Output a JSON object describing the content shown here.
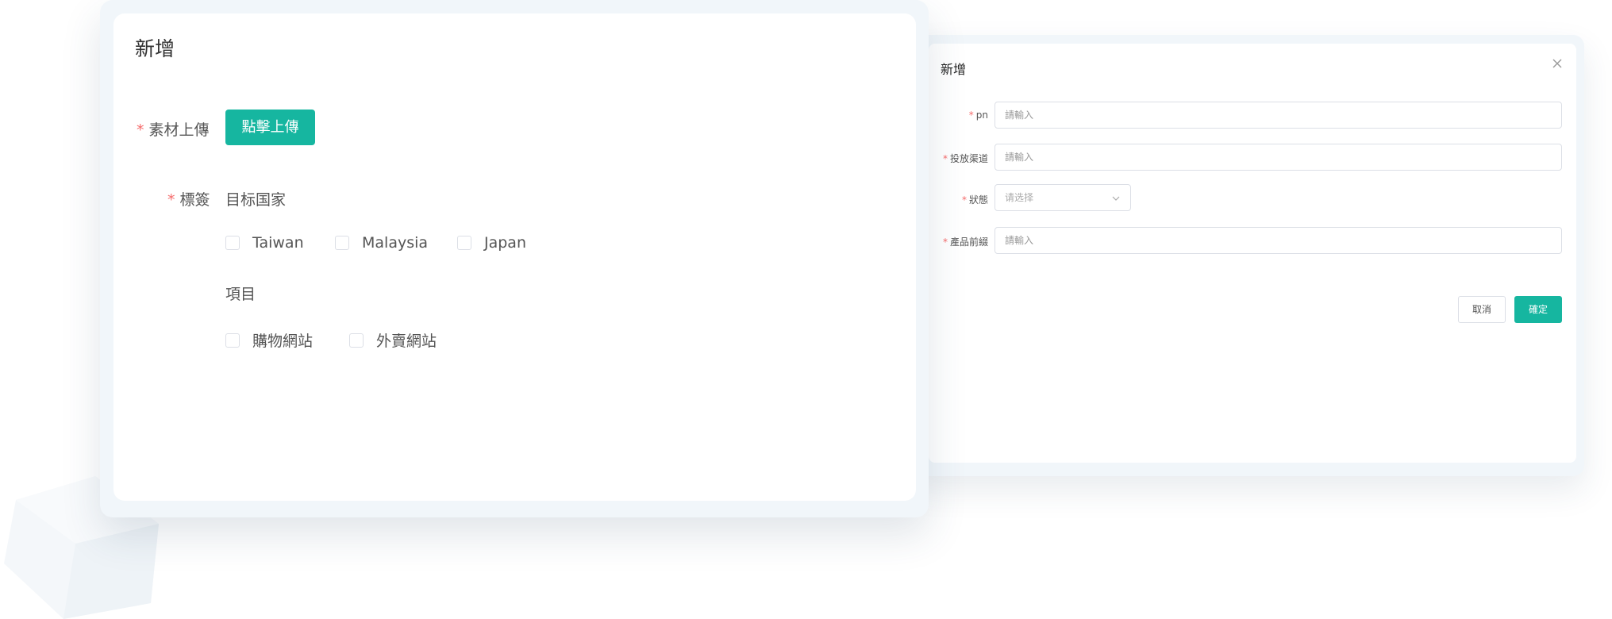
{
  "back_dialog": {
    "title": "新增",
    "fields": [
      {
        "label": "pn",
        "placeholder": "請輸入"
      },
      {
        "label": "投放渠道",
        "placeholder": "請輸入"
      },
      {
        "label": "狀態",
        "placeholder": "请选择"
      },
      {
        "label": "產品前綴",
        "placeholder": "請輸入"
      }
    ],
    "cancel_label": "取消",
    "ok_label": "確定"
  },
  "front_dialog": {
    "title": "新增",
    "upload_label": "素材上傳",
    "upload_button": "點擊上傳",
    "tags_label": "標簽",
    "groups": [
      {
        "title": "目标国家",
        "options": [
          "Taiwan",
          "Malaysia",
          "Japan"
        ]
      },
      {
        "title": "項目",
        "options": [
          "購物網站",
          "外賣網站"
        ]
      }
    ]
  },
  "colors": {
    "accent": "#16b6a0",
    "required": "#f56c6c",
    "frame": "#f1f6fa"
  }
}
